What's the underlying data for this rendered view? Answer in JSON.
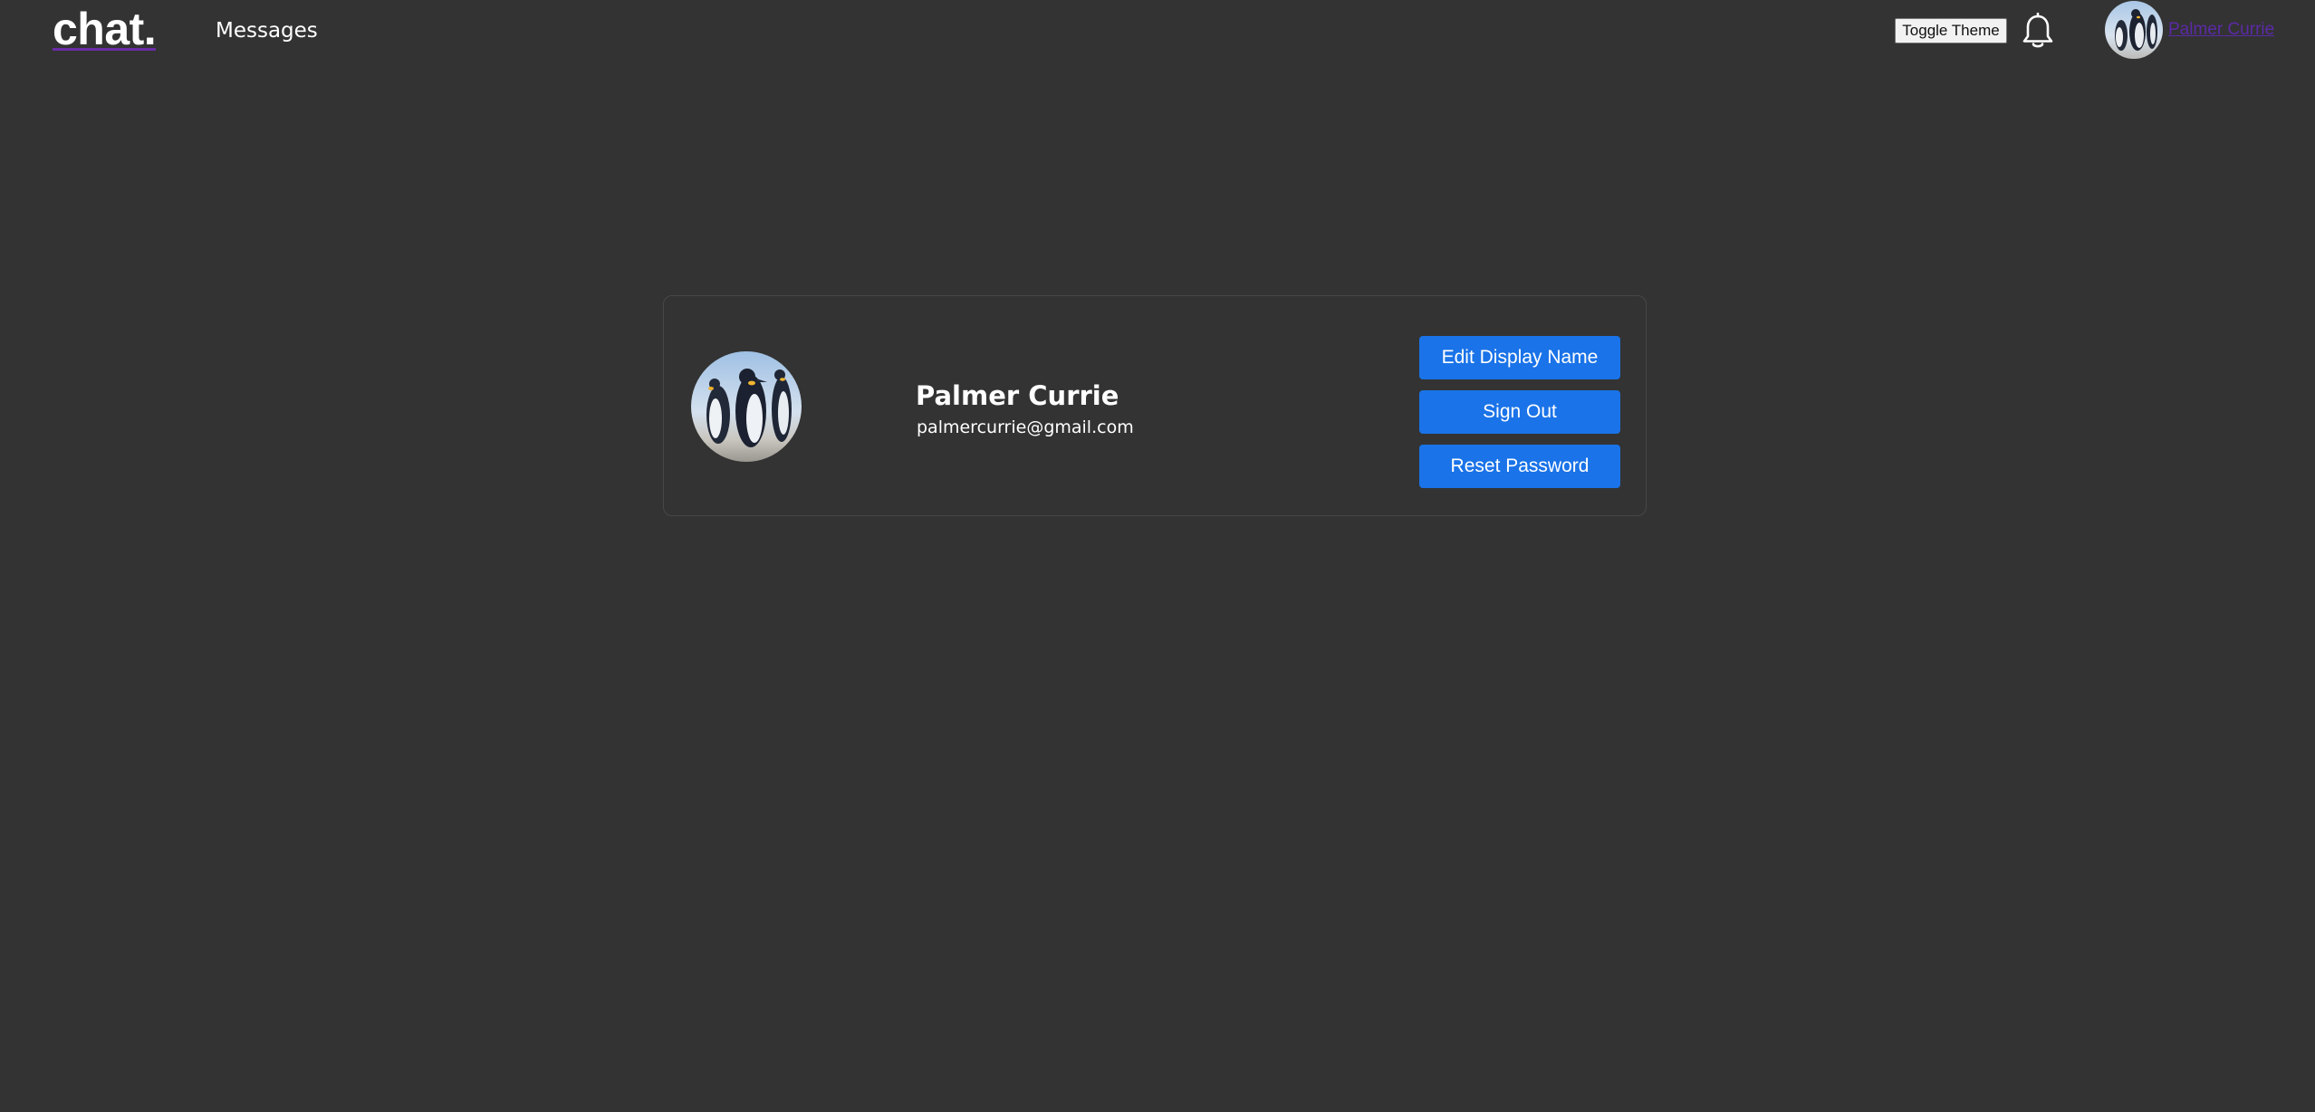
{
  "header": {
    "logo": "chat.",
    "nav_messages": "Messages",
    "toggle_theme_label": "Toggle Theme",
    "notification_icon": "bell-icon",
    "username": "Palmer Currie"
  },
  "profile": {
    "display_name": "Palmer Currie",
    "email": "palmercurrie@gmail.com",
    "buttons": {
      "edit_display_name": "Edit Display Name",
      "sign_out": "Sign Out",
      "reset_password": "Reset Password"
    }
  },
  "colors": {
    "background": "#333333",
    "button_blue": "#1a73e8",
    "link_purple": "#5b2aa6",
    "logo_underline": "#6a2ca8"
  }
}
